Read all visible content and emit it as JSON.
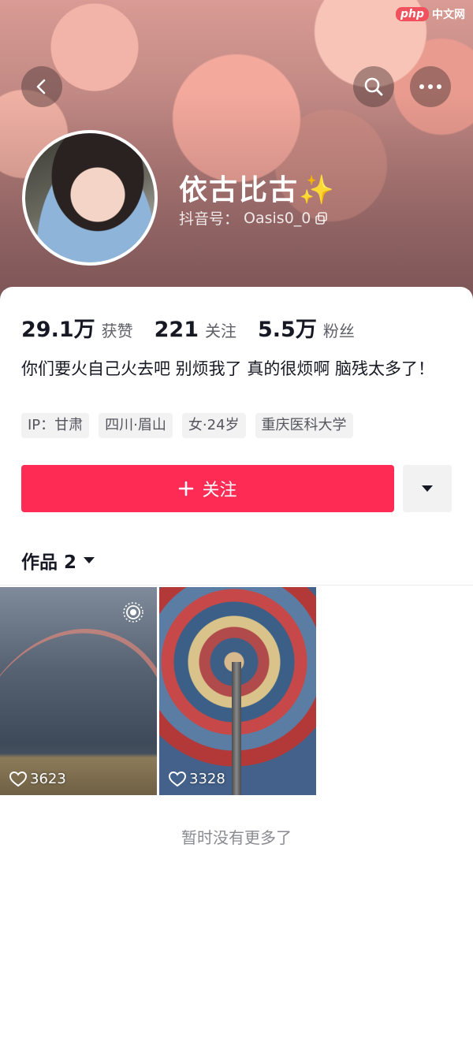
{
  "brand": {
    "logo_text": "php",
    "site": "中文网"
  },
  "header": {
    "username": "依古比古✨",
    "id_label": "抖音号：",
    "id_value": "Oasis0_0"
  },
  "stats": [
    {
      "value": "29.1万",
      "label": "获赞"
    },
    {
      "value": "221",
      "label": "关注"
    },
    {
      "value": "5.5万",
      "label": "粉丝"
    }
  ],
  "bio": "你们要火自己火去吧 别烦我了 真的很烦啊 脑残太多了！",
  "tags": [
    "IP：甘肃",
    "四川·眉山",
    "女·24岁",
    "重庆医科大学"
  ],
  "actions": {
    "follow_label": "关注",
    "follow_plus": "+"
  },
  "works": {
    "title": "作品 2",
    "items": [
      {
        "likes": "3623"
      },
      {
        "likes": "3328"
      }
    ]
  },
  "footer": {
    "no_more": "暂时没有更多了"
  },
  "colors": {
    "accent": "#fe2c55",
    "tag_bg": "#f2f2f3"
  },
  "icons": [
    "back-arrow-icon",
    "search-icon",
    "more-dots-icon",
    "copy-icon",
    "plus-icon",
    "caret-down-icon",
    "heart-icon",
    "live-icon"
  ]
}
